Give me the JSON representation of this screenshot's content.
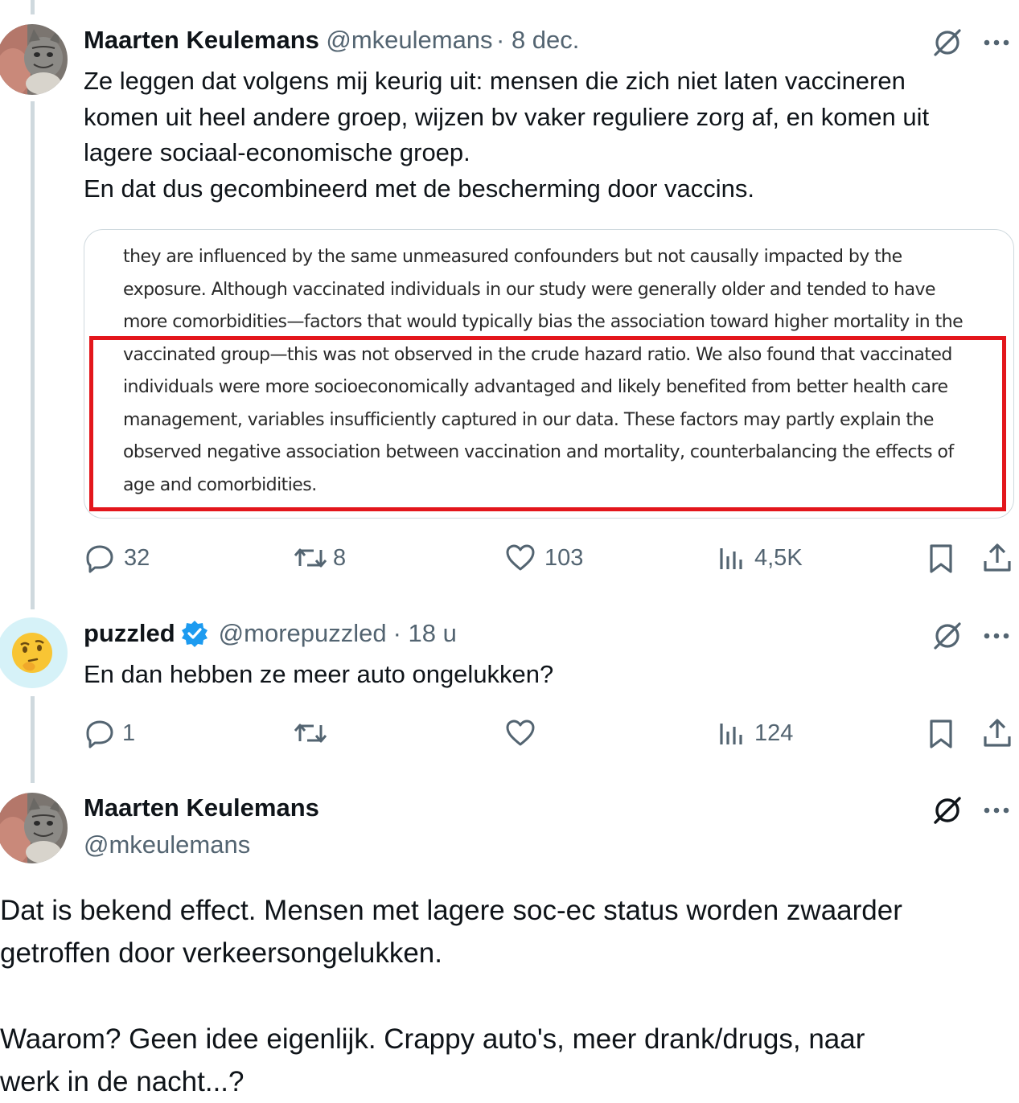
{
  "tweet1": {
    "name": "Maarten Keulemans",
    "handle": "@mkeulemans",
    "date": "· 8 dec.",
    "lines": [
      "Ze leggen dat volgens mij keurig uit: mensen die zich niet laten vaccineren",
      "komen uit heel andere groep, wijzen bv vaker reguliere zorg af, en komen uit",
      "lagere sociaal-economische groep.",
      "En dat dus gecombineerd met de bescherming door vaccins."
    ],
    "quote_lines": [
      "they are influenced by the same unmeasured confounders but not causally impacted by the",
      "exposure. Although vaccinated individuals in our study were generally older and tended to have",
      "more comorbidities—factors that would typically bias the association toward higher mortality in the",
      "vaccinated group—this was not observed in the crude hazard ratio. We also found that vaccinated",
      "individuals were more socioeconomically advantaged and likely benefited from better health care",
      "management, variables insufficiently captured in our data. These factors may partly explain the",
      "observed negative association between vaccination and mortality, counterbalancing the effects of",
      "age and comorbidities."
    ],
    "actions": {
      "replies": "32",
      "reposts": "8",
      "likes": "103",
      "views": "4,5K"
    }
  },
  "tweet2": {
    "name": "puzzled",
    "handle": "@morepuzzled",
    "date": "· 18 u",
    "text": "En dan hebben ze meer auto ongelukken?",
    "avatar_emoji": "🤔",
    "actions": {
      "replies": "1",
      "views": "124"
    }
  },
  "tweet3": {
    "name": "Maarten Keulemans",
    "handle": "@mkeulemans",
    "lines": [
      "Dat is bekend effect. Mensen met lagere soc-ec status worden zwaarder",
      "getroffen door verkeersongelukken.",
      "",
      "Waarom? Geen idee eigenlijk. Crappy auto's, meer drank/drugs, naar",
      "werk in de nacht...?"
    ]
  },
  "colors": {
    "verified": "#1d9bf0",
    "muted": "#536471",
    "highlight": "#e3161c",
    "thread_line": "#cfd9de"
  },
  "icons": [
    "grok-icon",
    "more-icon",
    "reply-icon",
    "repost-icon",
    "like-icon",
    "views-icon",
    "bookmark-icon",
    "share-icon",
    "verified-badge-icon"
  ]
}
